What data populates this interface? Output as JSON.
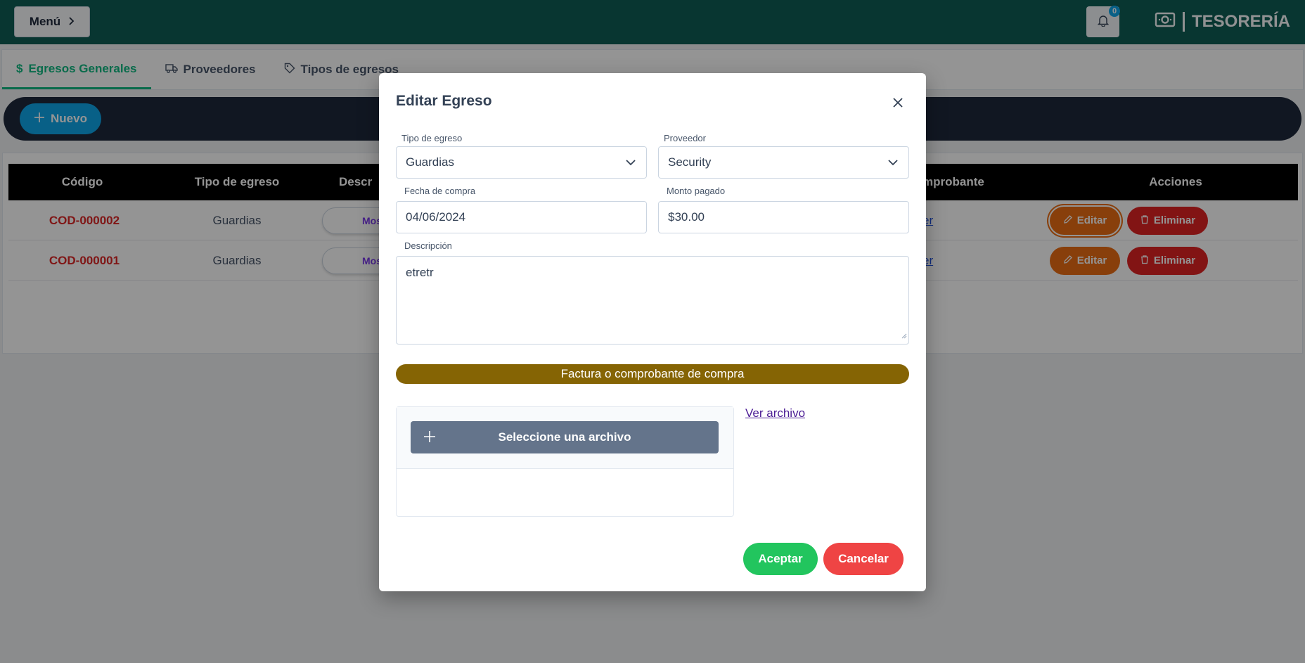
{
  "topbar": {
    "menu_label": "Menú",
    "notification_count": "0",
    "brand_label": "TESORERÍA"
  },
  "tabs": [
    {
      "label": "Egresos Generales",
      "active": true
    },
    {
      "label": "Proveedores",
      "active": false
    },
    {
      "label": "Tipos de egresos",
      "active": false
    }
  ],
  "toolbar": {
    "new_label": "Nuevo"
  },
  "table": {
    "headers": {
      "codigo": "Código",
      "tipo": "Tipo de egreso",
      "descripcion": "Descr",
      "comprobante": "mprobante",
      "acciones": "Acciones"
    },
    "rows": [
      {
        "codigo": "COD-000002",
        "tipo": "Guardias",
        "desc_btn": "Mos",
        "comp_link": "er",
        "edit": "Editar",
        "delete": "Eliminar"
      },
      {
        "codigo": "COD-000001",
        "tipo": "Guardias",
        "desc_btn": "Mos",
        "comp_link": "er",
        "edit": "Editar",
        "delete": "Eliminar"
      }
    ]
  },
  "modal": {
    "title": "Editar Egreso",
    "tipo_label": "Tipo de egreso",
    "tipo_value": "Guardias",
    "proveedor_label": "Proveedor",
    "proveedor_value": "Security",
    "fecha_label": "Fecha de compra",
    "fecha_value": "04/06/2024",
    "monto_label": "Monto pagado",
    "monto_value": "$30.00",
    "descripcion_label": "Descripción",
    "descripcion_value": "etretr",
    "banner": "Factura o comprobante de compra",
    "select_file_label": "Seleccione una archivo",
    "ver_archivo": "Ver archivo",
    "accept": "Aceptar",
    "cancel": "Cancelar"
  },
  "colors": {
    "topbar": "#0f5e55",
    "active_tab": "#10b981",
    "banner": "#856404",
    "accept": "#22c55e",
    "cancel": "#ef4444",
    "edit": "#ea6d13",
    "delete": "#e02424"
  }
}
